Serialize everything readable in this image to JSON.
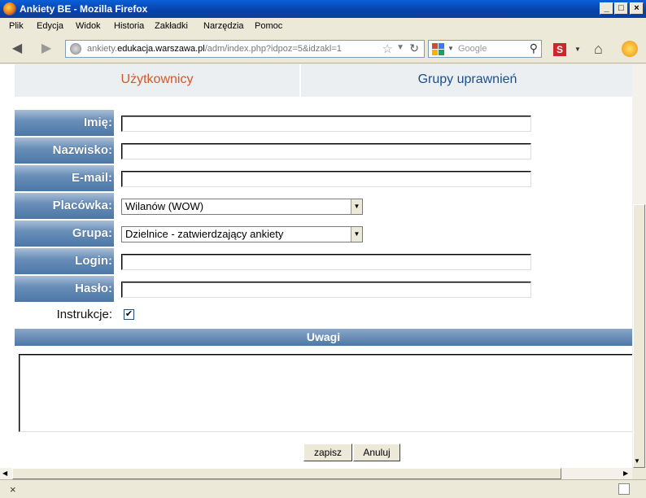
{
  "window": {
    "title": "Ankiety BE - Mozilla Firefox"
  },
  "menu": [
    "Plik",
    "Edycja",
    "Widok",
    "Historia",
    "Zakładki",
    "Narzędzia",
    "Pomoc"
  ],
  "nav": {
    "url_host_prefix": "ankiety.",
    "url_host_main": "edukacja.warszawa.pl",
    "url_path": "/adm/index.php?idpoz=5&idzakl=1",
    "search_placeholder": "Google",
    "s_button": "S"
  },
  "tabs": {
    "users": "Użytkownicy",
    "groups": "Grupy uprawnień"
  },
  "form": {
    "imie_label": "Imię:",
    "nazwisko_label": "Nazwisko:",
    "email_label": "E-mail:",
    "placowka_label": "Placówka:",
    "placowka_value": "Wilanów (WOW)",
    "grupa_label": "Grupa:",
    "grupa_value": "Dzielnice - zatwierdzający ankiety",
    "login_label": "Login:",
    "haslo_label": "Hasło:",
    "instrukcje_label": "Instrukcje:",
    "instrukcje_checked": "✔",
    "uwagi_label": "Uwagi",
    "save_label": "zapisz",
    "cancel_label": "Anuluj"
  },
  "status": {
    "close_glyph": "×"
  }
}
